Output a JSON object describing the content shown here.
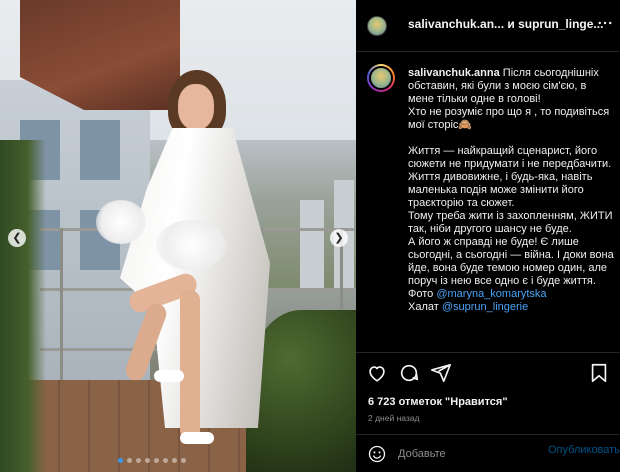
{
  "header": {
    "author": "salivanchuk.an...",
    "conjunction": " и ",
    "coauthor": "suprun_linge..."
  },
  "caption": {
    "username": "salivanchuk.anna",
    "paragraphs": [
      "Після сьогоднішніх обставин, які були з моєю сім'єю, в мене тільки одне в голові!",
      "Хто не розуміє про що я , то подивіться мої сторіс🙈",
      "Життя — найкращий сценарист, його сюжети не придумати і не передбачити. Життя дивовижне, і будь-яка, навіть маленька подія може змінити його траєкторію та сюжет.",
      "Тому треба жити із захопленням, ЖИТИ так, ніби другого шансу не буде.",
      "А його ж справді не буде! Є лише сьогодні, а сьогодні — війна. І доки вона йде, вона буде темою номер один, але поруч із нею все одно є і буде життя."
    ],
    "photo_label": "Фото",
    "photo_link": "@maryna_komarytska",
    "robe_label": "Халат",
    "robe_link": "@suprun_lingerie"
  },
  "actions": {
    "like_icon": "heart-icon",
    "comment_icon": "comment-icon",
    "share_icon": "share-icon",
    "save_icon": "bookmark-icon"
  },
  "likes_text": "6 723 отметок \"Нравится\"",
  "date_text": "2 дней назад",
  "comment": {
    "placeholder": "Добавьте",
    "post_label": "Опубликовать"
  },
  "carousel": {
    "slide_count": 8,
    "active_index": 0
  },
  "colors": {
    "accent": "#0095f6",
    "link": "#4aa3f7",
    "muted": "#8e8e8e",
    "background": "#000000"
  }
}
